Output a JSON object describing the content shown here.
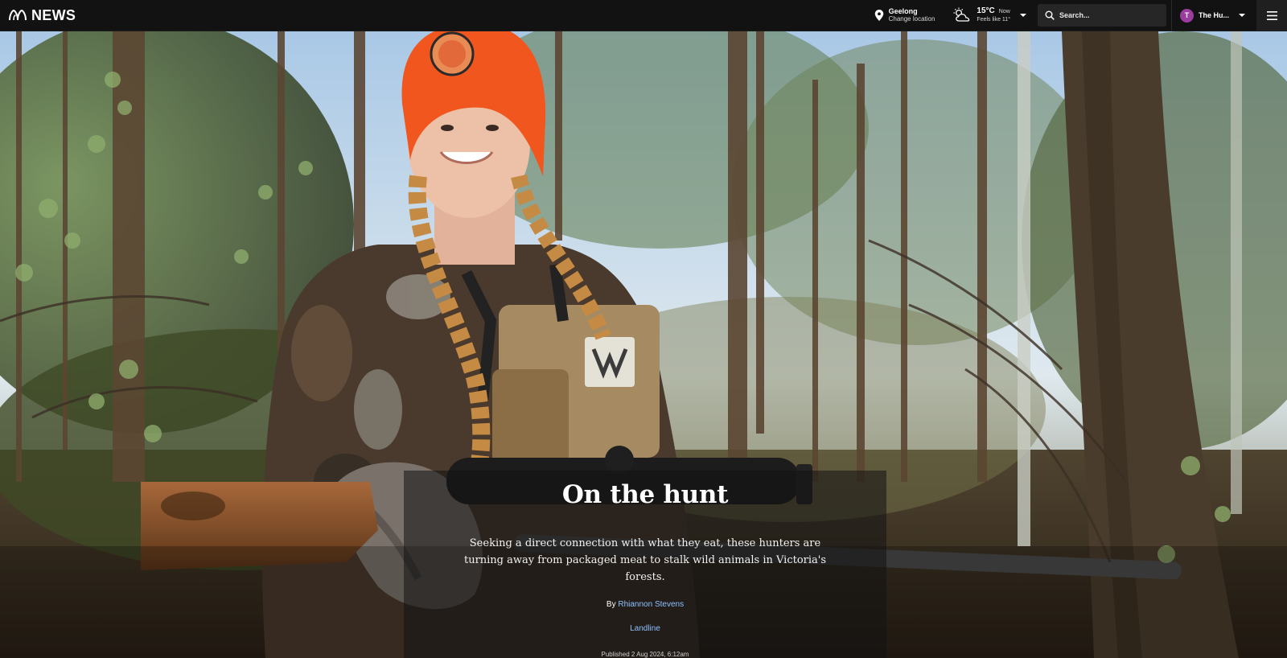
{
  "header": {
    "logo_text": "NEWS",
    "location": {
      "city": "Geelong",
      "change_label": "Change location"
    },
    "weather": {
      "temperature": "15°C",
      "now_label": "Now",
      "feels_like": "Feels like 11°"
    },
    "search": {
      "placeholder": "Search..."
    },
    "profile": {
      "initial": "T",
      "name": "The Hu..."
    }
  },
  "article": {
    "headline": "On the hunt",
    "standfirst": "Seeking a direct connection with what they eat, these hunters are turning away from packaged meat to stalk wild animals in Victoria's forests.",
    "byline_prefix": "By",
    "author": "Rhiannon Stevens",
    "program": "Landline",
    "published": "Published 2 Aug 2024, 6:12am"
  },
  "colors": {
    "brand_bar": "#121212",
    "link_blue": "#8ec0ff",
    "avatar": "#9b3d9f",
    "beanie_orange": "#f0561d"
  }
}
